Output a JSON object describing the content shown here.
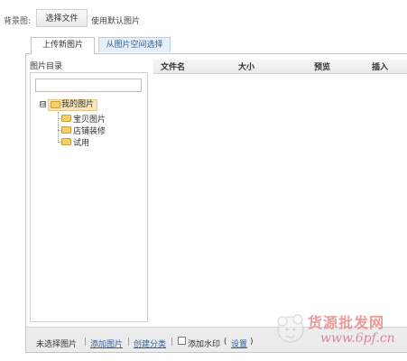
{
  "background": {
    "label": "背景图:",
    "choose_file": "选择文件",
    "use_default": "使用默认图片"
  },
  "tabs": [
    {
      "label": "上传新图片",
      "active": true
    },
    {
      "label": "从图片空间选择",
      "active": false
    }
  ],
  "directory": {
    "title": "图片目录",
    "search_placeholder": "",
    "toggle": "⊟",
    "root": "我的图片",
    "children": [
      "宝贝图片",
      "店铺装修",
      "试用"
    ]
  },
  "file_table": {
    "columns": [
      "文件名",
      "大小",
      "预览",
      "插入"
    ]
  },
  "bottom_bar": {
    "status": "未选择图片",
    "sep": "|",
    "add_image": "添加图片",
    "create_category": "创建分类",
    "watermark_label": "添加水印",
    "settings_open": "(",
    "settings": "设置",
    "settings_close": ")"
  },
  "watermark": {
    "brand": "货源批发网",
    "url": "www.6pf.cn"
  },
  "colors": {
    "link": "#2f5e9a",
    "folder": "#f3d06b",
    "selected_node": "#fbe5b8"
  }
}
